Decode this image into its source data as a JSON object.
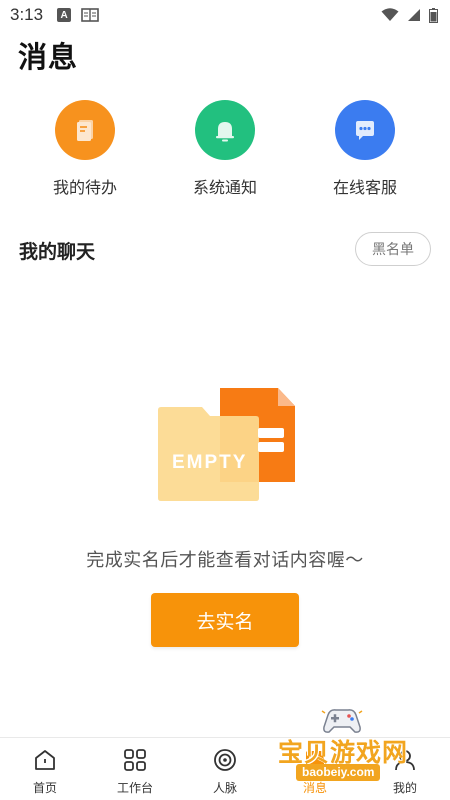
{
  "status_bar": {
    "time": "3:13",
    "indicator_letter": "A"
  },
  "page_title": "消息",
  "quick_entries": [
    {
      "label": "我的待办",
      "icon": "todo-icon",
      "color": "#f7921e"
    },
    {
      "label": "系统通知",
      "icon": "bell-icon",
      "color": "#22c07f"
    },
    {
      "label": "在线客服",
      "icon": "chat-bubble-icon",
      "color": "#3b7cf0"
    }
  ],
  "section": {
    "title": "我的聊天",
    "blacklist_label": "黑名单"
  },
  "empty_state": {
    "illustration_text": "EMPTY",
    "message": "完成实名后才能查看对话内容喔～",
    "button_label": "去实名"
  },
  "bottom_nav": [
    {
      "label": "首页",
      "icon": "home-icon"
    },
    {
      "label": "工作台",
      "icon": "grid-icon"
    },
    {
      "label": "人脉",
      "icon": "contacts-icon"
    },
    {
      "label": "消息",
      "icon": "message-icon",
      "active": true
    },
    {
      "label": "我的",
      "icon": "profile-icon"
    }
  ],
  "watermark": {
    "title": "宝贝游戏网",
    "url": "baobeiy.com"
  },
  "colors": {
    "accent": "#f7930a"
  }
}
